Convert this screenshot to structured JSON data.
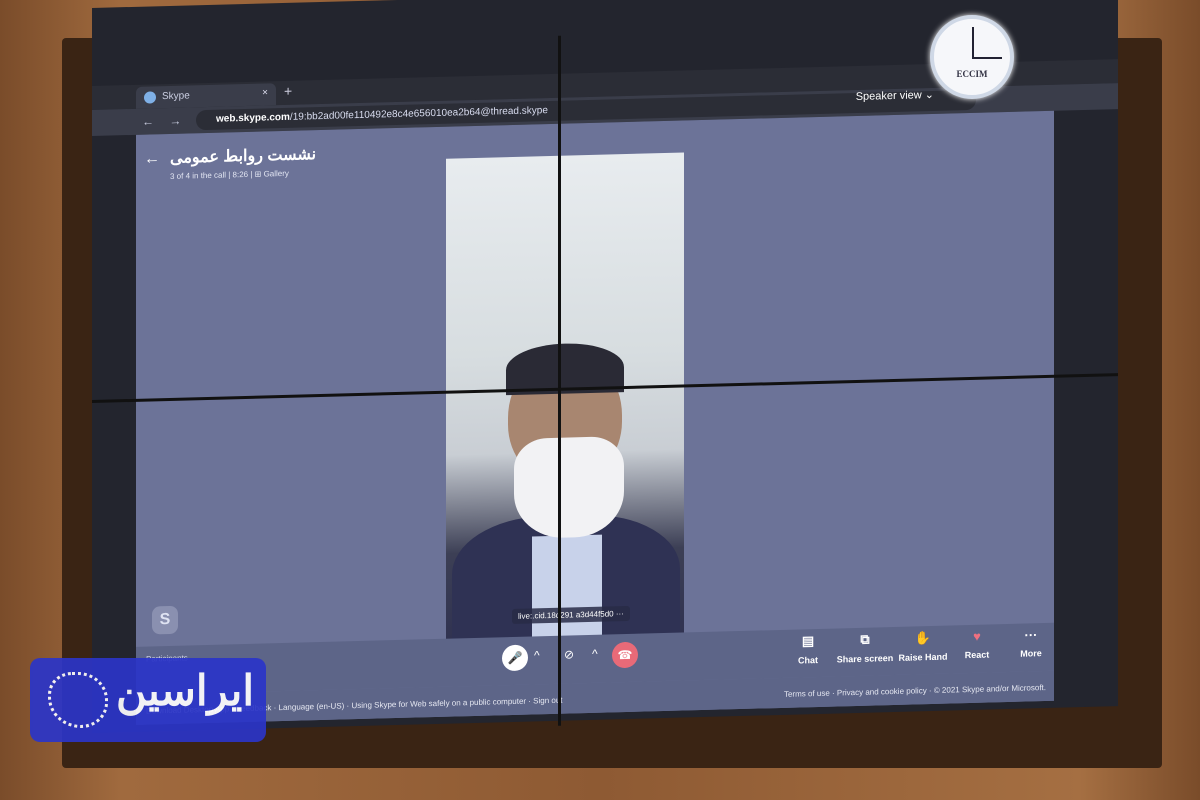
{
  "browser": {
    "tab_title": "Skype",
    "new_tab": "+",
    "close": "×",
    "url_host": "web.skype.com",
    "url_path": "/19:bb2ad00fe110492e8c4e656010ea2b64@thread.skype",
    "nav": "← → ⟳"
  },
  "call": {
    "title": "نشست روابط عمومی",
    "subtitle": "3 of 4 in the call | 8:26 | ⊞ Gallery",
    "view_mode": "Speaker view ⌄",
    "participant_id": "live:.cid.18d291 a3d44f5d0 ···"
  },
  "controls": {
    "participants": "Participants",
    "mic": "🎤",
    "mic_chevron": "^",
    "video": "⊘",
    "video_chevron": "^",
    "hangup": "☎",
    "actions": [
      {
        "icon": "▤",
        "label": "Chat"
      },
      {
        "icon": "⧉",
        "label": "Share screen"
      },
      {
        "icon": "✋",
        "label": "Raise Hand"
      },
      {
        "icon": "♥",
        "label": "React"
      },
      {
        "icon": "···",
        "label": "More"
      }
    ]
  },
  "footer": {
    "left": "Download Desktop App · Feedback · Language (en-US) · Using Skype for Web safely on a public computer · Sign out",
    "right": "Terms of use · Privacy and cookie policy · © 2021 Skype and/or Microsoft."
  },
  "clock": {
    "brand": "ECCIM"
  },
  "watermark": {
    "text": "ایراسین"
  },
  "colors": {
    "app_bg": "#6c7398",
    "hangup": "#e86a78",
    "react": "#f07080",
    "watermark": "#2b35c8"
  }
}
